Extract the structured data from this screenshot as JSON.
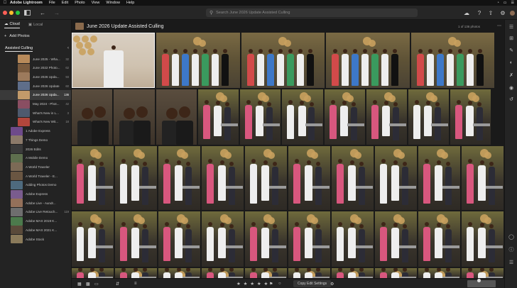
{
  "menubar": {
    "app_name": "Adobe Lightroom",
    "menus": [
      "File",
      "Edit",
      "Photo",
      "View",
      "Window",
      "Help"
    ]
  },
  "toolbar": {
    "search_placeholder": "Search June 2026 Update Assisted Culling"
  },
  "sidebar": {
    "tabs": [
      {
        "label": "Cloud",
        "active": true
      },
      {
        "label": "Local",
        "active": false
      }
    ],
    "add_photos_label": "Add Photos",
    "album_header": "Assisted Culling",
    "albums": [
      {
        "name": "June 2025 - Wha...",
        "count": "32",
        "thumb": "#b88a5a",
        "selected": false
      },
      {
        "name": "June 2022 Photo...",
        "count": "62",
        "thumb": "#7a5b3e",
        "selected": false
      },
      {
        "name": "June 2026 Upda...",
        "count": "93",
        "thumb": "#9c7a5c",
        "selected": false
      },
      {
        "name": "June 2026 Update",
        "count": "60",
        "thumb": "#5f6e8a",
        "selected": false
      },
      {
        "name": "June 2026 Upda...",
        "count": "136",
        "thumb": "#c29a6a",
        "selected": true
      },
      {
        "name": "May 2024 - Phot...",
        "count": "42",
        "thumb": "#8a4e62",
        "selected": false
      },
      {
        "name": "What's New in L...",
        "count": "3",
        "thumb": "#4e5a6e",
        "selected": false
      },
      {
        "name": "What's New Wit...",
        "count": "18",
        "thumb": "#b2463c",
        "selected": false
      },
      {
        "name": "1 Adobe Express",
        "count": "",
        "thumb": "#6e4a8a",
        "selected": false
      },
      {
        "name": "7 Things Demo",
        "count": "",
        "thumb": "#8c7a6a",
        "selected": false
      },
      {
        "name": "2026 Edits",
        "count": "",
        "thumb": "#3b3b3b",
        "selected": false
      },
      {
        "name": "A Mobile Demo",
        "count": "",
        "thumb": "#5e6f4e",
        "selected": false
      },
      {
        "name": "A World Traveler",
        "count": "",
        "thumb": "#7c6a56",
        "selected": false
      },
      {
        "name": "A World Traveler - E...",
        "count": "",
        "thumb": "#6a5642",
        "selected": false
      },
      {
        "name": "Adding Photos Demo",
        "count": "",
        "thumb": "#4e6a7e",
        "selected": false
      },
      {
        "name": "Adobe Express",
        "count": "",
        "thumb": "#7a5c8e",
        "selected": false
      },
      {
        "name": "Adobe Live - Aundr...",
        "count": "",
        "thumb": "#94705a",
        "selected": false
      },
      {
        "name": "Adobe Live Retouch...",
        "count": "119",
        "thumb": "#6e6e6e",
        "selected": false
      },
      {
        "name": "Adobe MAX 2019 K...",
        "count": "",
        "thumb": "#4c7a4c",
        "selected": false
      },
      {
        "name": "Adobe MAX 2021 K...",
        "count": "",
        "thumb": "#5a4a3a",
        "selected": false
      },
      {
        "name": "Adobe Stock",
        "count": "",
        "thumb": "#8a7a5a",
        "selected": false
      }
    ]
  },
  "main": {
    "album_title": "June 2026 Update Assisted Culling",
    "photo_count": "1 of 136 photos"
  },
  "bottombar": {
    "stars": "★ ★ ★ ★ ★",
    "copy_edit_label": "Copy Edit Settings"
  },
  "colors": {
    "accent": "#e8e8e8",
    "background": "#1d1d1d",
    "sidebar": "#232323",
    "wall_olive": "#6f6a3c",
    "wall_dark": "#3a352c",
    "dress_pink": "#d8577e",
    "dress_white": "#eeeeee",
    "balloon_gold": "#c9a15e"
  },
  "photo_scenes": [
    "portrait",
    "group",
    "group",
    "group",
    "group",
    "selfie",
    "selfie",
    "selfie",
    "party",
    "party",
    "party",
    "party",
    "party",
    "party",
    "party",
    "party",
    "party",
    "party",
    "party",
    "party",
    "party",
    "party",
    "party",
    "party",
    "party",
    "party",
    "party",
    "party",
    "party",
    "party",
    "party",
    "party",
    "party",
    "party",
    "party",
    "party",
    "party",
    "party",
    "party",
    "party",
    "party",
    "party",
    "party",
    "party"
  ]
}
